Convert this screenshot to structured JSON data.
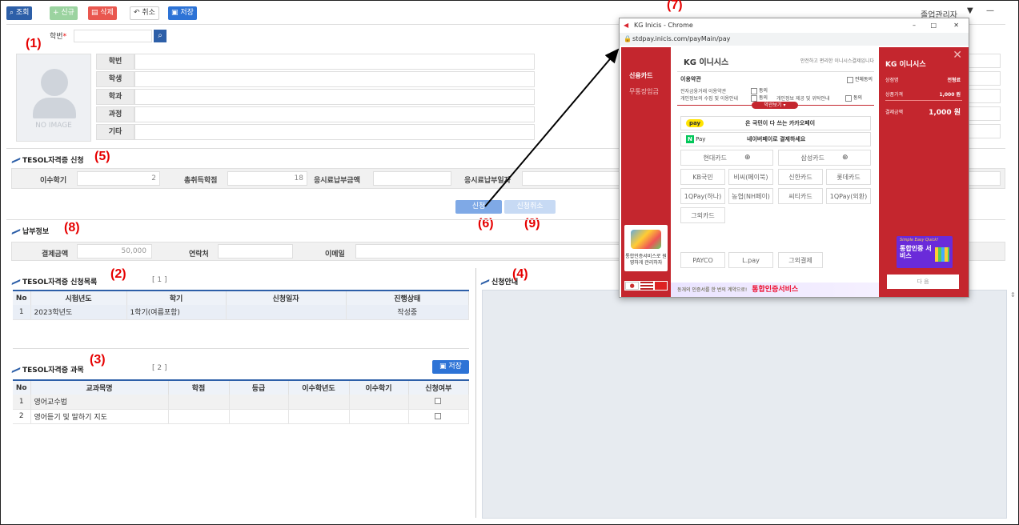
{
  "toolbar": {
    "search": "조회",
    "new": "신규",
    "delete": "삭제",
    "cancel": "취소",
    "save": "저장"
  },
  "header": {
    "user": "졸업관리자"
  },
  "student": {
    "id_label": "학번",
    "photo_text": "NO IMAGE",
    "fields": [
      "학번",
      "학생",
      "학과",
      "과정",
      "기타"
    ]
  },
  "application": {
    "title": "TESOL자격증 신청",
    "semester_label": "이수학기",
    "semester_value": "2",
    "credits_label": "총취득학점",
    "credits_value": "18",
    "fee_label": "응시료납부금액",
    "fee_date_label": "응시료납부일자"
  },
  "actions": {
    "apply": "신청",
    "cancel_apply": "신청취소"
  },
  "payment": {
    "title": "납부정보",
    "amount_label": "결제금액",
    "amount_value": "50,000",
    "contact_label": "연락처",
    "email_label": "이메일"
  },
  "app_list": {
    "title": "TESOL자격증 신청목록",
    "count": "[ 1 ]",
    "headers": [
      "No",
      "시험년도",
      "학기",
      "신청일자",
      "진행상태"
    ],
    "rows": [
      [
        "1",
        "2023학년도",
        "1학기(여름포함)",
        "",
        "작성중"
      ]
    ]
  },
  "courses": {
    "title": "TESOL자격증 과목",
    "count": "[ 2 ]",
    "save": "저장",
    "headers": [
      "No",
      "교과목명",
      "학점",
      "등급",
      "이수학년도",
      "이수학기",
      "신청여부"
    ],
    "rows": [
      [
        "1",
        "영어교수법"
      ],
      [
        "2",
        "영어듣기 및 말하기 지도"
      ]
    ]
  },
  "guide": {
    "title": "신청안내"
  },
  "annotations": {
    "a1": "(1)",
    "a2": "(2)",
    "a3": "(3)",
    "a4": "(4)",
    "a5": "(5)",
    "a6": "(6)",
    "a7": "(7)",
    "a8": "(8)",
    "a9": "(9)"
  },
  "popup": {
    "window_title": "KG Inicis - Chrome",
    "url": "stdpay.inicis.com/payMain/pay",
    "brand": "KG 이니시스",
    "tagline": "안전하고 편리한 이니시스결제입니다",
    "methods": [
      "신용카드",
      "무통장입금"
    ],
    "terms_title": "이용약관",
    "agree_all": "전체동의",
    "term1": "전자금융거래 이용약관",
    "term2": "개인정보의 수집 및 이용안내",
    "term3": "개인정보 제공 및 위탁안내",
    "agree": "동의",
    "view_terms": "약관보기",
    "kakao_badge": "pay",
    "kakao_text": "온 국민이 다 쓰는 카카오페이",
    "naver_badge": "N Pay",
    "naver_text": "네이버페이로 결제하세요",
    "hyundai": "현대카드",
    "samsung": "삼성카드",
    "cards": [
      "KB국민",
      "비씨(페이북)",
      "신한카드",
      "롯데카드",
      "1QPay(하나)",
      "농협(NH페이)",
      "씨티카드",
      "1QPay(외환)",
      "그외카드"
    ],
    "others": [
      "PAYCO",
      "L.pay",
      "그외결제"
    ],
    "side_brand": "KG 이니시스",
    "product_label": "상점명",
    "product_value": "전형료",
    "price_label": "상품가격",
    "price_value": "1,000 원",
    "total_label": "결제금액",
    "total_value": "1,000 원",
    "next": "다 음",
    "promo_small": "Simple Easy Quick!",
    "promo_big": "통합인증 서비스",
    "left_promo": "통합인증서비스로 원영하게 관리하자",
    "banner": "통합인증서비스",
    "banner_pre": "동개의 인증서를 한 번의 계약으로!"
  },
  "colors": {
    "blue": "#2d5fa8",
    "red": "#d9252f",
    "popup_red": "#c4262e",
    "annot": "#e60000"
  }
}
